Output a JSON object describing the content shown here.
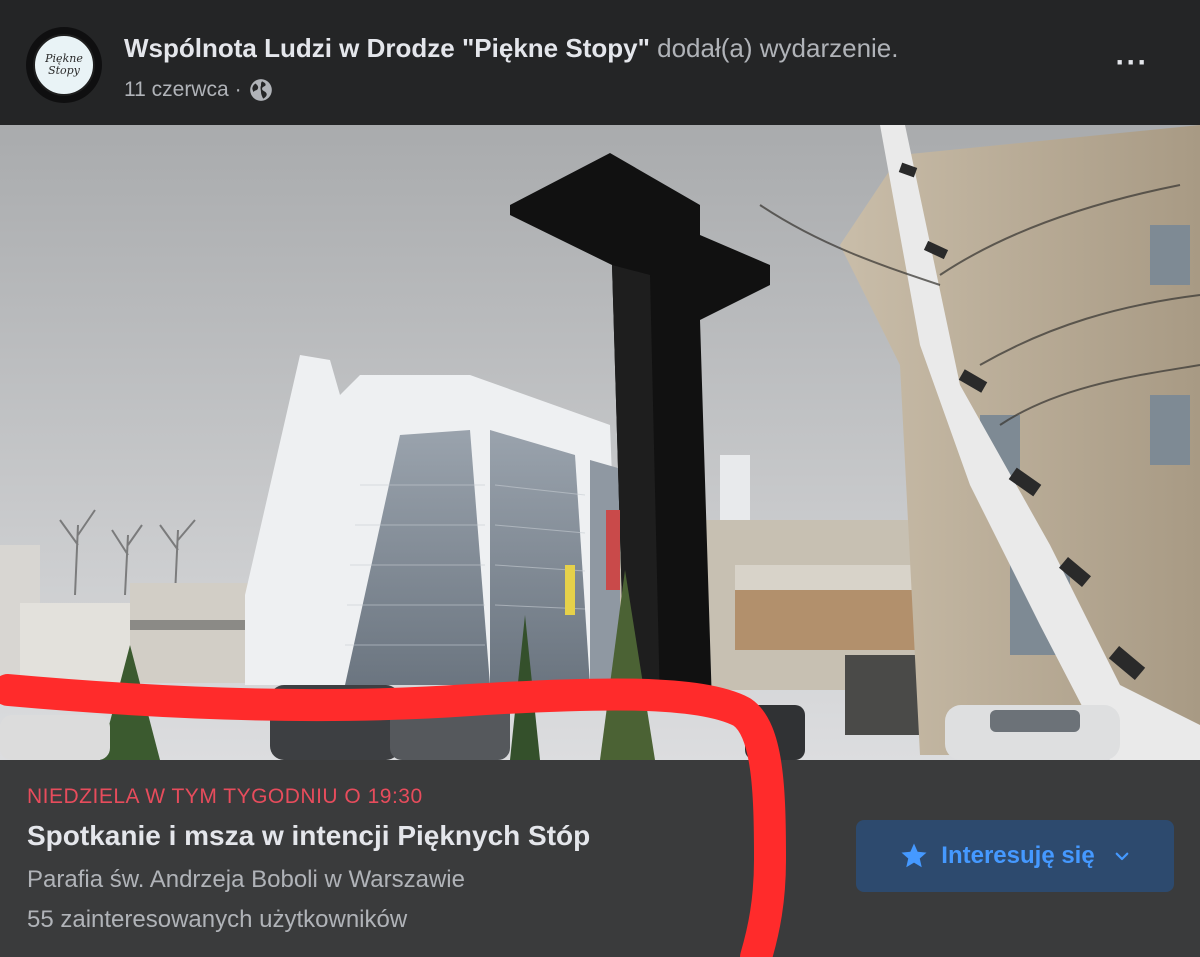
{
  "post": {
    "author": "Wspólnota Ludzi w Drodze \"Piękne Stopy\"",
    "action": "dodał(a) wydarzenie.",
    "date": "11 czerwca",
    "separator": "·",
    "privacy_icon": "globe-icon",
    "more_label": "···",
    "avatar_text_line1": "Piękne",
    "avatar_text_line2": "Stopy"
  },
  "event": {
    "date_label": "NIEDZIELA W TYM TYGODNIU O 19:30",
    "title": "Spotkanie i msza w intencji Pięknych Stóp",
    "place": "Parafia św. Andrzeja Boboli w Warszawie",
    "interested": "55 zainteresowanych użytkowników",
    "interest_button": "Interesuję się",
    "interest_icon": "star-icon",
    "dropdown_icon": "chevron-down-icon"
  },
  "colors": {
    "background": "#242526",
    "event_bg": "#3a3b3c",
    "date_red": "#e74c5c",
    "button_bg": "#2d4a6e",
    "button_text": "#4599ff",
    "annotation_red": "#ff2b2b"
  }
}
